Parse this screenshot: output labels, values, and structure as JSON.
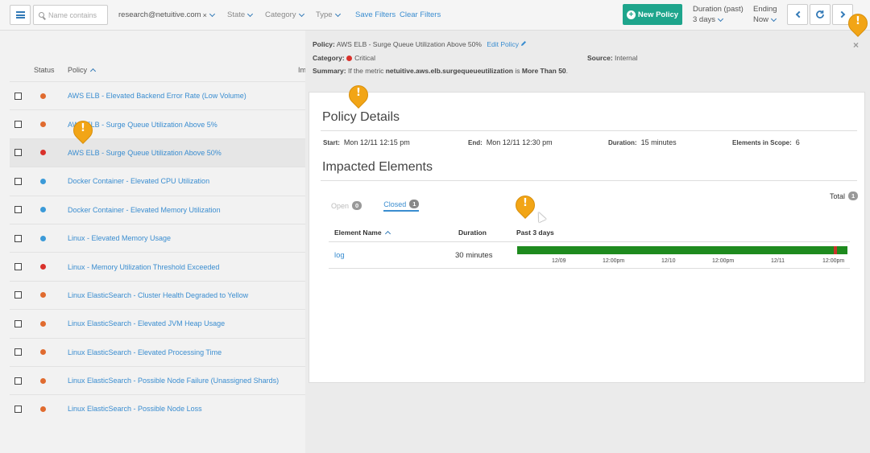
{
  "toolbar": {
    "search_placeholder": "Name contains",
    "account_filter": "research@netuitive.com",
    "account_remove": "×",
    "state_label": "State",
    "category_label": "Category",
    "type_label": "Type",
    "save_filters": "Save Filters",
    "clear_filters": "Clear Filters",
    "new_policy": "New Policy",
    "duration_label": "Duration (past)",
    "duration_value": "3 days",
    "ending_label": "Ending",
    "ending_value": "Now"
  },
  "list": {
    "headers": {
      "status": "Status",
      "policy": "Policy",
      "im": "Im"
    },
    "rows": [
      {
        "name": "AWS ELB - Elevated Backend Error Rate (Low Volume)",
        "status": "orange"
      },
      {
        "name": "AWS ELB - Surge Queue Utilization Above 5%",
        "status": "orange"
      },
      {
        "name": "AWS ELB - Surge Queue Utilization Above 50%",
        "status": "red",
        "selected": true
      },
      {
        "name": "Docker Container - Elevated CPU Utilization",
        "status": "blue"
      },
      {
        "name": "Docker Container - Elevated Memory Utilization",
        "status": "blue"
      },
      {
        "name": "Linux - Elevated Memory Usage",
        "status": "blue"
      },
      {
        "name": "Linux - Memory Utilization Threshold Exceeded",
        "status": "red"
      },
      {
        "name": "Linux ElasticSearch - Cluster Health Degraded to Yellow",
        "status": "orange"
      },
      {
        "name": "Linux ElasticSearch - Elevated JVM Heap Usage",
        "status": "orange"
      },
      {
        "name": "Linux ElasticSearch - Elevated Processing Time",
        "status": "orange"
      },
      {
        "name": "Linux ElasticSearch - Possible Node Failure (Unassigned Shards)",
        "status": "orange"
      },
      {
        "name": "Linux ElasticSearch - Possible Node Loss",
        "status": "orange"
      }
    ]
  },
  "detail": {
    "policy_label": "Policy:",
    "policy_value": "AWS ELB - Surge Queue Utilization Above 50%",
    "edit_policy": "Edit Policy",
    "category_label": "Category:",
    "category_value": "Critical",
    "source_label": "Source:",
    "source_value": "Internal",
    "summary_label": "Summary:",
    "summary_pre": "If the metric",
    "summary_metric": "netuitive.aws.elb.surgequeueutilization",
    "summary_mid": "is",
    "summary_cond": "More Than 50",
    "summary_end": ".",
    "close": "×",
    "policy_details_title": "Policy Details",
    "start_label": "Start:",
    "start_value": "Mon 12/11 12:15 pm",
    "end_label": "End:",
    "end_value": "Mon 12/11 12:30 pm",
    "duration_label": "Duration:",
    "duration_value": "15 minutes",
    "elements_label": "Elements in Scope:",
    "elements_value": "6",
    "impacted_title": "Impacted Elements",
    "tab_open": "Open",
    "tab_open_count": "0",
    "tab_closed": "Closed",
    "tab_closed_count": "1",
    "total_label": "Total",
    "total_count": "1",
    "col_element": "Element Name",
    "col_duration": "Duration",
    "col_past": "Past 3 days",
    "row_element": "log",
    "row_duration": "30 minutes",
    "ticks": [
      "12/09",
      "12:00pm",
      "12/10",
      "12:00pm",
      "12/11",
      "12:00pm"
    ]
  },
  "colors": {
    "accent": "#3a8dd0",
    "new_policy": "#1ea58c",
    "critical": "#d9312b",
    "warning": "#e06b2f",
    "info": "#3b9ad8",
    "timeline_ok": "#1e8a1e",
    "callout": "#f2a516"
  },
  "icons": [
    "hamburger-icon",
    "search-icon",
    "chevron-down-icon",
    "plus-circle-icon",
    "refresh-icon",
    "chevron-left-icon",
    "chevron-right-icon",
    "pencil-icon",
    "close-icon",
    "sort-up-icon",
    "callout-marker-icon"
  ]
}
